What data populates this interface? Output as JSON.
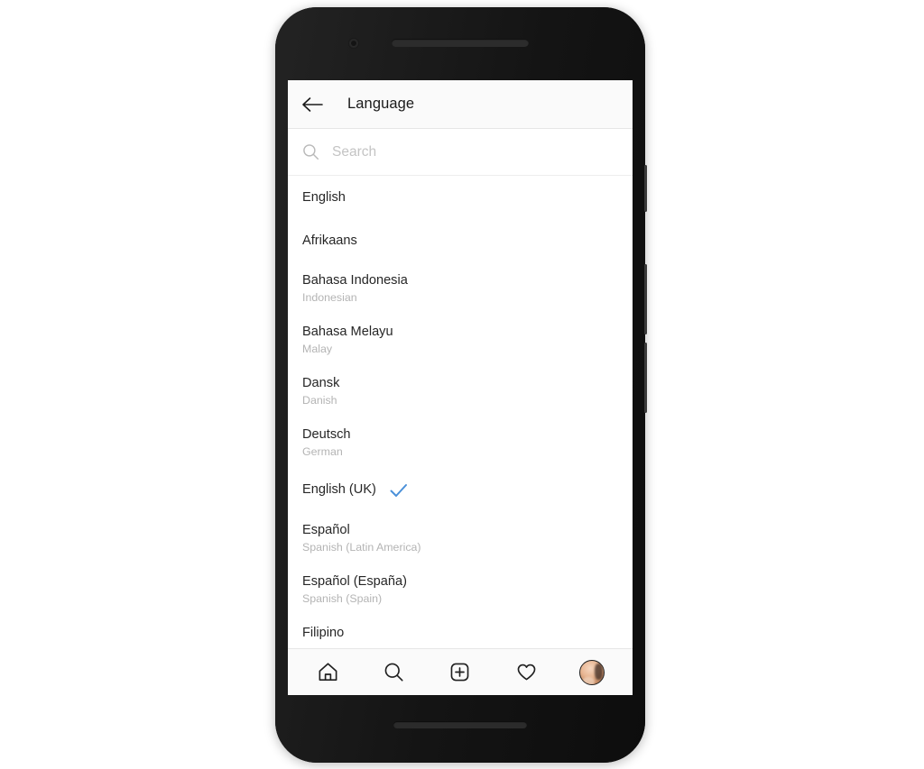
{
  "device": {
    "frame_color": "#1d1d1d",
    "camera_icon": "front-camera",
    "earpiece_icon": "earpiece-speaker",
    "bottom_speaker_icon": "bottom-speaker"
  },
  "header": {
    "back_icon": "arrow-left-icon",
    "title": "Language"
  },
  "search": {
    "icon": "search-icon",
    "placeholder": "Search",
    "value": ""
  },
  "languages": [
    {
      "native": "English",
      "english": ""
    },
    {
      "native": "Afrikaans",
      "english": ""
    },
    {
      "native": "Bahasa Indonesia",
      "english": "Indonesian"
    },
    {
      "native": "Bahasa Melayu",
      "english": "Malay"
    },
    {
      "native": "Dansk",
      "english": "Danish"
    },
    {
      "native": "Deutsch",
      "english": "German"
    },
    {
      "native": "English (UK)",
      "english": "",
      "selected": true
    },
    {
      "native": "Español",
      "english": "Spanish (Latin America)"
    },
    {
      "native": "Español (España)",
      "english": "Spanish (Spain)"
    },
    {
      "native": "Filipino",
      "english": "",
      "clipped": true
    }
  ],
  "selection": {
    "check_icon": "check-icon",
    "check_color": "#4a90d9"
  },
  "bottom_nav": {
    "items": [
      {
        "name": "home",
        "icon": "home-icon"
      },
      {
        "name": "search",
        "icon": "search-icon"
      },
      {
        "name": "add",
        "icon": "plus-square-icon"
      },
      {
        "name": "activity",
        "icon": "heart-icon"
      },
      {
        "name": "profile",
        "icon": "avatar-icon"
      }
    ]
  }
}
